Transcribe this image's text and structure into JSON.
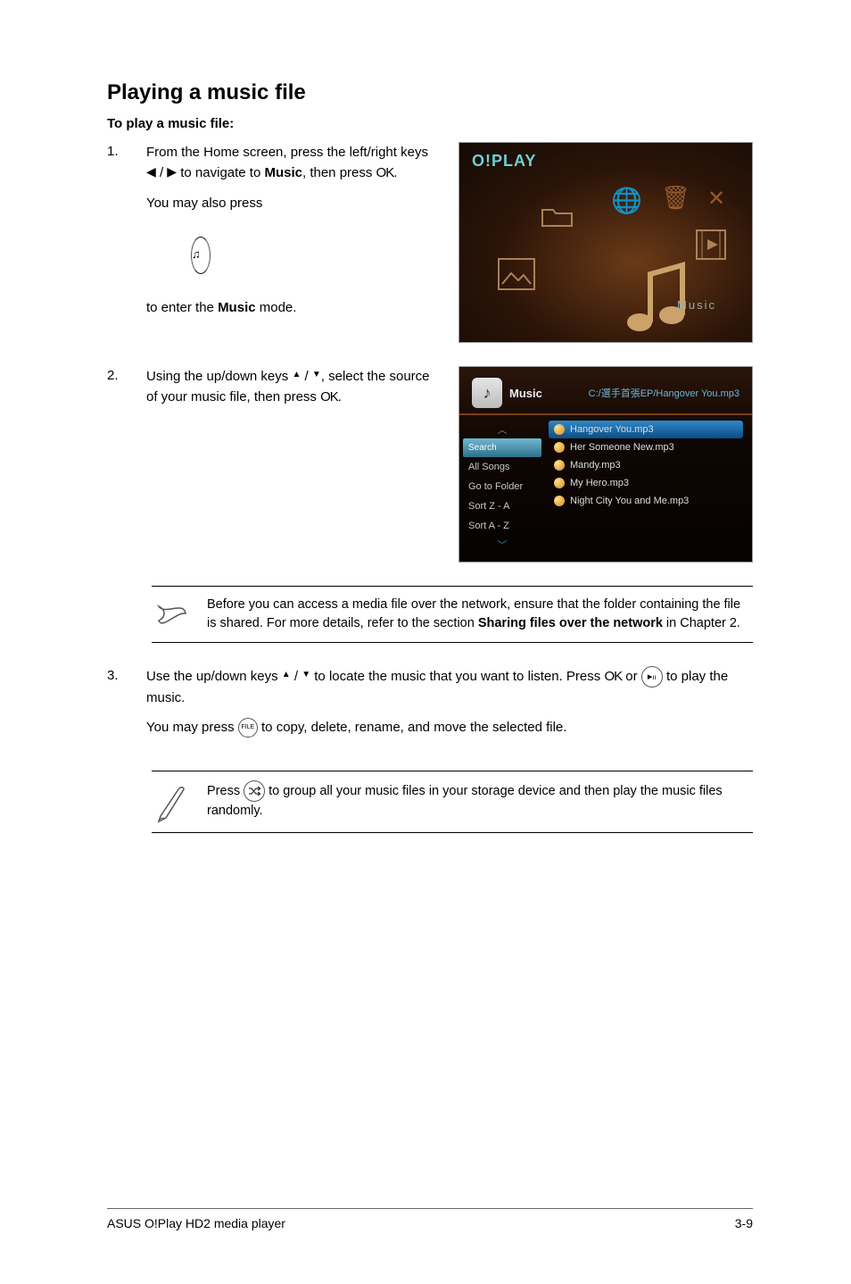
{
  "heading": "Playing a music file",
  "subheading": "To play a music file:",
  "step1": {
    "num": "1.",
    "p1_a": "From the Home screen, press the left/right keys ",
    "p1_b": " / ",
    "p1_c": " to navigate to ",
    "p1_bold": "Music",
    "p1_d": ", then press ",
    "p1_ok": "OK",
    "p1_e": ".",
    "p2_a": "You may also press ",
    "p2_b": " to enter the ",
    "p2_bold": "Music",
    "p2_c": " mode."
  },
  "shot1": {
    "logo": "O!PLAY",
    "label": "Music"
  },
  "step2": {
    "num": "2.",
    "p1_a": "Using the up/down keys ",
    "p1_b": " / ",
    "p1_c": ", select the source of your music file, then press ",
    "p1_ok": "OK",
    "p1_d": "."
  },
  "shot2": {
    "title": "Music",
    "path": "C:/選手首張EP/Hangover You.mp3",
    "side": {
      "search": "Search",
      "all": "All Songs",
      "goto": "Go to Folder",
      "sortza": "Sort Z - A",
      "sortaz": "Sort A - Z"
    },
    "list": {
      "i0": "Hangover You.mp3",
      "i1": "Her Someone New.mp3",
      "i2": "Mandy.mp3",
      "i3": "My Hero.mp3",
      "i4": "Night City You and Me.mp3"
    }
  },
  "note1": {
    "a": "Before you can access a media file over the network, ensure that the folder containing the file is shared. For more details, refer to the section ",
    "bold": "Sharing files over the network",
    "b": " in Chapter 2."
  },
  "step3": {
    "num": "3.",
    "p1_a": "Use the up/down keys ",
    "p1_b": " / ",
    "p1_c": " to locate the music that you want to listen. Press ",
    "p1_ok": "OK",
    "p1_d": " or ",
    "p1_e": " to play the music.",
    "p2_a": "You may press ",
    "p2_b": " to copy, delete, rename, and move the selected file."
  },
  "note2": {
    "a": "Press ",
    "b": " to group all your music files in your storage device and then play the music files randomly."
  },
  "footer": {
    "left": "ASUS O!Play HD2 media player",
    "right": "3-9"
  }
}
